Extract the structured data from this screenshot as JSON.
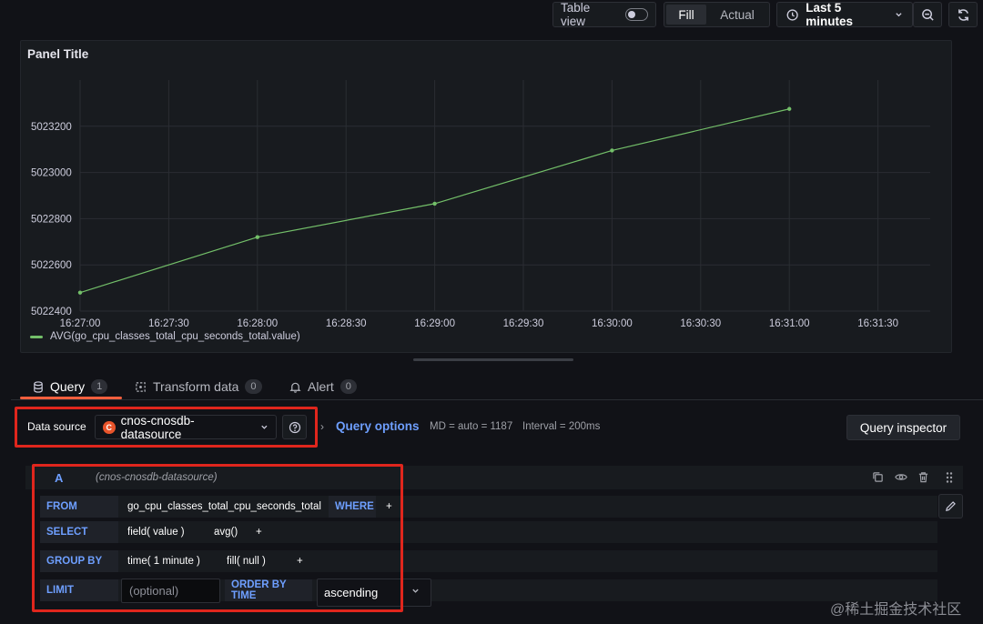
{
  "toolbar": {
    "table_view_label": "Table view",
    "table_view_on": false,
    "fill_label": "Fill",
    "actual_label": "Actual",
    "time_range_label": "Last 5 minutes"
  },
  "panel": {
    "title": "Panel Title",
    "legend_label": "AVG(go_cpu_classes_total_cpu_seconds_total.value)"
  },
  "chart_data": {
    "type": "line",
    "title": "Panel Title",
    "x_ticks": [
      "16:27:00",
      "16:27:30",
      "16:28:00",
      "16:28:30",
      "16:29:00",
      "16:29:30",
      "16:30:00",
      "16:30:30",
      "16:31:00",
      "16:31:30"
    ],
    "y_ticks": [
      5022400,
      5022600,
      5022800,
      5023000,
      5023200
    ],
    "ylim": [
      5022400,
      5023400
    ],
    "series": [
      {
        "name": "AVG(go_cpu_classes_total_cpu_seconds_total.value)",
        "color": "#73bf69",
        "x": [
          "16:27:00",
          "16:28:00",
          "16:29:00",
          "16:30:00",
          "16:31:00"
        ],
        "values": [
          5022480,
          5022720,
          5022865,
          5023095,
          5023275
        ]
      }
    ],
    "grid": true,
    "legend": "bottom-left"
  },
  "tabs": [
    {
      "label": "Query",
      "count": "1"
    },
    {
      "label": "Transform data",
      "count": "0"
    },
    {
      "label": "Alert",
      "count": "0"
    }
  ],
  "datasource": {
    "label": "Data source",
    "name": "cnos-cnosdb-datasource"
  },
  "query_options": {
    "link": "Query options",
    "md": "MD = auto = 1187",
    "interval": "Interval = 200ms"
  },
  "query_inspector_label": "Query inspector",
  "query": {
    "ref_id": "A",
    "datasource_hint": "(cnos-cnosdb-datasource)",
    "from_kw": "FROM",
    "from_value": "go_cpu_classes_total_cpu_seconds_total",
    "where_kw": "WHERE",
    "select_kw": "SELECT",
    "select_field": "field(  value  )",
    "select_agg": "avg()",
    "groupby_kw": "GROUP BY",
    "groupby_time": "time(  1 minute  )",
    "groupby_fill": "fill(  null  )",
    "limit_kw": "LIMIT",
    "limit_placeholder": "(optional)",
    "order_kw": "ORDER BY TIME",
    "order_value": "ascending",
    "plus": "+"
  },
  "watermark": "@稀土掘金技术社区"
}
